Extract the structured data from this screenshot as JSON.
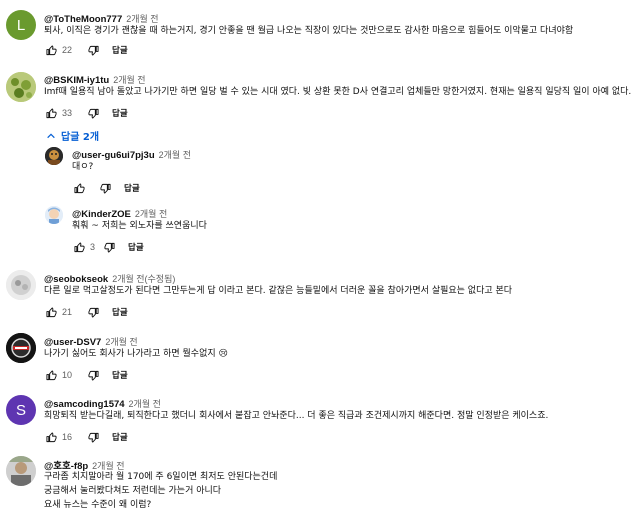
{
  "actions": {
    "reply_label": "답글"
  },
  "c1": {
    "avatar_letter": "L",
    "avatar_color": "#6a9a2e",
    "author": "@ToTheMoon777",
    "time": "2개월 전",
    "text": "퇴사, 이직은 경기가 괜찮을 때 하는거지, 경기 안좋을 땐 월급 나오는 직장이 있다는 것만으로도 감사한 마음으로 힘들어도 이악물고 다녀야함",
    "likes": "22"
  },
  "c2": {
    "author": "@BSKIM-iy1tu",
    "time": "2개월 전",
    "text": "Imf때 일용직 남아 돌았고 나가기만 하면 일당 벌 수 있는 시대 였다. 빚 상환 못한 D사 연결고리 업체들만 망한거였지. 현재는 일용직  일당직 일이 아예 없다.",
    "likes": "33",
    "replies_label": "답글 2개"
  },
  "r1": {
    "author": "@user-gu6ui7pj3u",
    "time": "2개월 전",
    "text": "대ㅇ?"
  },
  "r2": {
    "author": "@KinderZOE",
    "time": "2개월 전",
    "text": "훠훠 ~ 저희는 외노자를 쓰연웁니다",
    "likes": "3"
  },
  "c3": {
    "author": "@seobokseok",
    "time": "2개월 전(수정됨)",
    "text": "다른 일로 먹고살정도가 된다면 그만두는게 답 이라고 본다. 같잖은 능들밑에서 더러운 꼴을 참아가면서 살필요는 없다고 본다",
    "likes": "21"
  },
  "c4": {
    "author": "@user-DSV7",
    "time": "2개월 전",
    "text": "나가기 싫어도 회사가 나가라고 하면 뭘수없지 😢",
    "likes": "10"
  },
  "c5": {
    "avatar_letter": "S",
    "avatar_color": "#5e35b1",
    "author": "@samcoding1574",
    "time": "2개월 전",
    "text": "희망퇴직 받는다길래, 퇴직한다고 했더니 회사에서 붙잡고 안놔준다...  더 좋은 직급과 조건제시까지 해준다면.  정말 인정받은 케이스죠.",
    "likes": "16"
  },
  "c6": {
    "author": "@호호-f8p",
    "time": "2개월 전",
    "lines": [
      "구라좀 치지말아라 월 170에 주 6일이면 최저도 안된다는건데",
      "궁금해서 눌러봤다쳐도 저런데는 가는거 아니다",
      "요새 뉴스는 수준이 왜 이럼?"
    ]
  }
}
